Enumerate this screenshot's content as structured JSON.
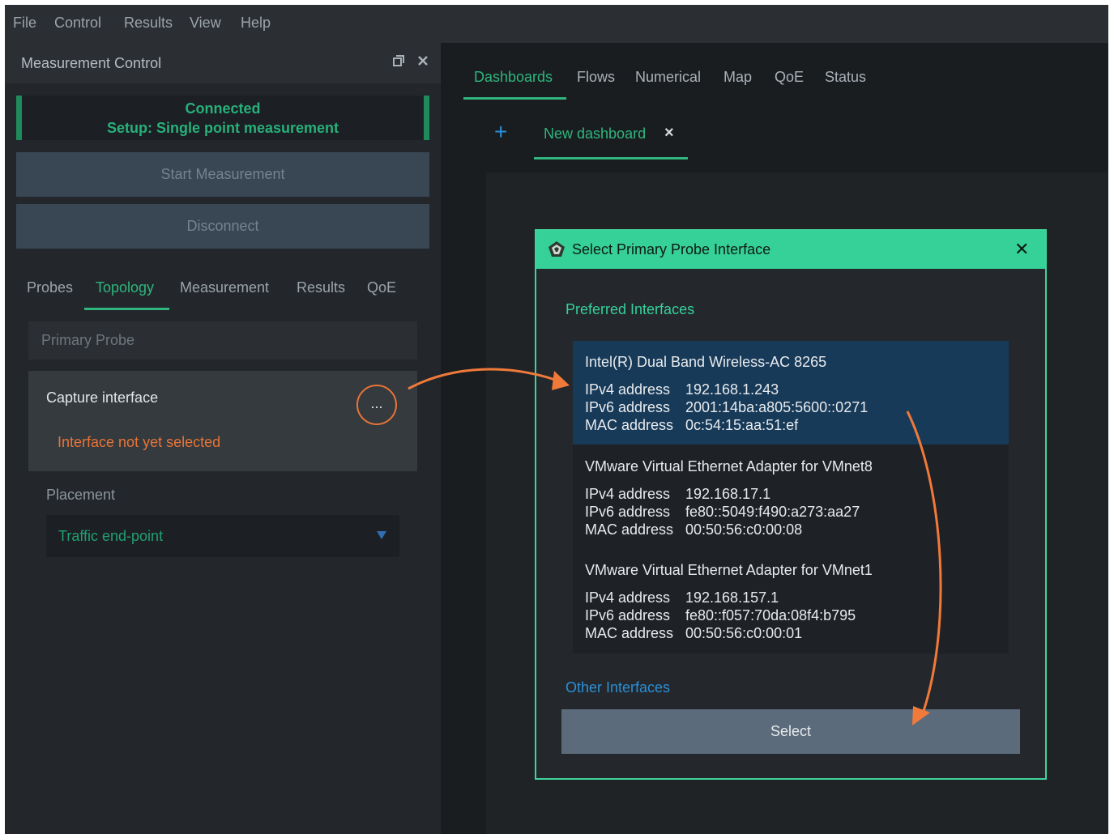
{
  "menubar": {
    "items": [
      "File",
      "Control",
      "Results",
      "View",
      "Help"
    ]
  },
  "left_panel": {
    "title": "Measurement Control",
    "icons": [
      "restore-icon",
      "close-icon"
    ],
    "status": {
      "line1": "Connected",
      "line2": "Setup: Single point measurement"
    },
    "start_button": "Start Measurement",
    "disconnect_button": "Disconnect",
    "tabs": [
      "Probes",
      "Topology",
      "Measurement",
      "Results",
      "QoE"
    ],
    "active_tab": "Topology",
    "primary_probe_label": "Primary Probe",
    "capture": {
      "label": "Capture interface",
      "button": "...",
      "warning": "Interface not yet selected"
    },
    "placement": {
      "label": "Placement",
      "value": "Traffic end-point"
    }
  },
  "main_tabs": [
    "Dashboards",
    "Flows",
    "Numerical",
    "Map",
    "QoE",
    "Status"
  ],
  "active_main_tab": "Dashboards",
  "dashboard_tab": {
    "add_icon": "+",
    "label": "New dashboard",
    "close": "×"
  },
  "dialog": {
    "title": "Select Primary Probe Interface",
    "close": "✕",
    "preferred_label": "Preferred Interfaces",
    "interfaces": [
      {
        "name": "Intel(R) Dual Band Wireless-AC 8265",
        "ipv4_key": "IPv4 address",
        "ipv4": "192.168.1.243",
        "ipv6_key": "IPv6 address",
        "ipv6": "2001:14ba:a805:5600::0271",
        "mac_key": "MAC address",
        "mac": "0c:54:15:aa:51:ef",
        "selected": true
      },
      {
        "name": "VMware Virtual Ethernet Adapter for VMnet8",
        "ipv4_key": "IPv4 address",
        "ipv4": "192.168.17.1",
        "ipv6_key": "IPv6 address",
        "ipv6": "fe80::5049:f490:a273:aa27",
        "mac_key": "MAC address",
        "mac": "00:50:56:c0:00:08",
        "selected": false
      },
      {
        "name": "VMware Virtual Ethernet Adapter for VMnet1",
        "ipv4_key": "IPv4 address",
        "ipv4": "192.168.157.1",
        "ipv6_key": "IPv6 address",
        "ipv6": "fe80::f057:70da:08f4:b795",
        "mac_key": "MAC address",
        "mac": "00:50:56:c0:00:01",
        "selected": false
      }
    ],
    "other_label": "Other Interfaces",
    "select_button": "Select"
  },
  "colors": {
    "accent": "#35d199",
    "warning": "#e87436",
    "link": "#2b8fd6",
    "selected_row": "#183a59",
    "annotation_arrow": "#f07a3a"
  }
}
